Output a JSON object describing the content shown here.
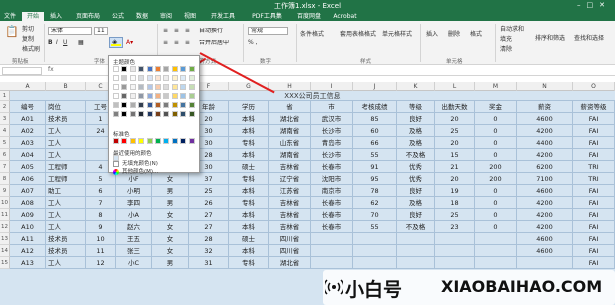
{
  "window": {
    "title": "工作簿1.xlsx - Excel"
  },
  "tabs": [
    "文件",
    "开始",
    "插入",
    "页面布局",
    "公式",
    "数据",
    "审阅",
    "视图",
    "开发工具",
    "PDF工具集",
    "百度网盘",
    "Acrobat"
  ],
  "ribbon": {
    "clipboard": {
      "label": "剪贴板",
      "cut": "剪切",
      "copy": "复制",
      "painter": "格式刷"
    },
    "font": {
      "label": "字体",
      "name": "宋体",
      "size": "11"
    },
    "align": {
      "label": "对齐方式",
      "wrap": "自动换行",
      "merge": "合并后居中"
    },
    "number": {
      "label": "数字",
      "format": "常规"
    },
    "styles": {
      "label": "样式",
      "cond": "条件格式",
      "table": "套用表格格式",
      "cellstyle": "单元格样式"
    },
    "cells": {
      "label": "单元格",
      "insert": "插入",
      "delete": "删除",
      "format": "格式"
    },
    "editing": {
      "autosum": "自动求和",
      "fill": "填充",
      "clear": "清除",
      "sort": "排序和筛选",
      "find": "查找和选择"
    }
  },
  "colors": {
    "excel_green": "#217346",
    "selection_fill": "#d5e4f1",
    "arrow": "#e02020"
  },
  "dropdown": {
    "theme_colors_label": "主题颜色",
    "standard_colors_label": "标准色",
    "recent_label": "最近使用的颜色",
    "no_fill": "无填充颜色(N)",
    "more_colors": "其他颜色(M)...",
    "theme_top": [
      "#ffffff",
      "#000000",
      "#e7e6e6",
      "#44546a",
      "#4472c4",
      "#ed7d31",
      "#a5a5a5",
      "#ffc000",
      "#5b9bd5",
      "#70ad47"
    ],
    "standard": [
      "#c00000",
      "#ff0000",
      "#ffc000",
      "#ffff00",
      "#92d050",
      "#00b050",
      "#00b0f0",
      "#0070c0",
      "#002060",
      "#7030a0"
    ],
    "recent": [
      "#d5e4f1"
    ]
  },
  "columns": [
    "A",
    "B",
    "C",
    "D",
    "E",
    "F",
    "G",
    "H",
    "I",
    "J",
    "K",
    "L",
    "M",
    "N",
    "O"
  ],
  "sheet_title": "XXX公司员工信息",
  "headers": [
    "编号",
    "岗位",
    "工号",
    "",
    "",
    "年龄",
    "学历",
    "省",
    "市",
    "考核成绩",
    "等级",
    "出勤天数",
    "奖金",
    "薪资",
    "薪资等级"
  ],
  "rows": [
    [
      "A01",
      "技术员",
      "1",
      "",
      "",
      "20",
      "本科",
      "湖北省",
      "武汉市",
      "85",
      "良好",
      "20",
      "0",
      "4600",
      "FAI"
    ],
    [
      "A02",
      "工人",
      "24",
      "",
      "",
      "30",
      "本科",
      "湖南省",
      "长沙市",
      "60",
      "及格",
      "25",
      "0",
      "4200",
      "FAI"
    ],
    [
      "A03",
      "工人",
      "",
      "",
      "",
      "30",
      "专科",
      "山东省",
      "青岛市",
      "66",
      "及格",
      "20",
      "0",
      "4400",
      "FAI"
    ],
    [
      "A04",
      "工人",
      "",
      "",
      "",
      "28",
      "本科",
      "湖南省",
      "长沙市",
      "55",
      "不及格",
      "15",
      "0",
      "4200",
      "FAI"
    ],
    [
      "A05",
      "工程师",
      "4",
      "小G",
      "女",
      "30",
      "硕士",
      "吉林省",
      "长春市",
      "91",
      "优秀",
      "21",
      "200",
      "6200",
      "TRI"
    ],
    [
      "A06",
      "工程师",
      "5",
      "小F",
      "女",
      "37",
      "专科",
      "辽宁省",
      "沈阳市",
      "95",
      "优秀",
      "20",
      "200",
      "7100",
      "TRI"
    ],
    [
      "A07",
      "助工",
      "6",
      "小明",
      "男",
      "25",
      "本科",
      "江苏省",
      "南京市",
      "78",
      "良好",
      "19",
      "0",
      "4600",
      "FAI"
    ],
    [
      "A08",
      "工人",
      "7",
      "李四",
      "男",
      "26",
      "专科",
      "吉林省",
      "长春市",
      "62",
      "及格",
      "18",
      "0",
      "4200",
      "FAI"
    ],
    [
      "A09",
      "工人",
      "8",
      "小A",
      "女",
      "27",
      "本科",
      "吉林省",
      "长春市",
      "70",
      "良好",
      "25",
      "0",
      "4200",
      "FAI"
    ],
    [
      "A10",
      "工人",
      "9",
      "赵六",
      "女",
      "27",
      "本科",
      "吉林省",
      "长春市",
      "55",
      "不及格",
      "23",
      "0",
      "4200",
      "FAI"
    ],
    [
      "A11",
      "技术员",
      "10",
      "王五",
      "女",
      "28",
      "硕士",
      "四川省",
      "",
      "",
      "",
      "",
      "",
      "4600",
      "FAI"
    ],
    [
      "A12",
      "技术员",
      "11",
      "张三",
      "女",
      "32",
      "本科",
      "四川省",
      "",
      "",
      "",
      "",
      "",
      "4600",
      "FAI"
    ],
    [
      "A13",
      "工人",
      "12",
      "小C",
      "男",
      "31",
      "专科",
      "湖北省",
      "",
      "",
      "",
      "",
      "",
      "",
      "FAI"
    ]
  ],
  "row_numbers": [
    "1",
    "2",
    "3",
    "4",
    "5",
    "6",
    "7",
    "8",
    "9",
    "10",
    "11",
    "12",
    "13",
    "14",
    "15"
  ],
  "watermark": {
    "brand": "小白号",
    "site": "XIAOBAIHAO.COM"
  }
}
